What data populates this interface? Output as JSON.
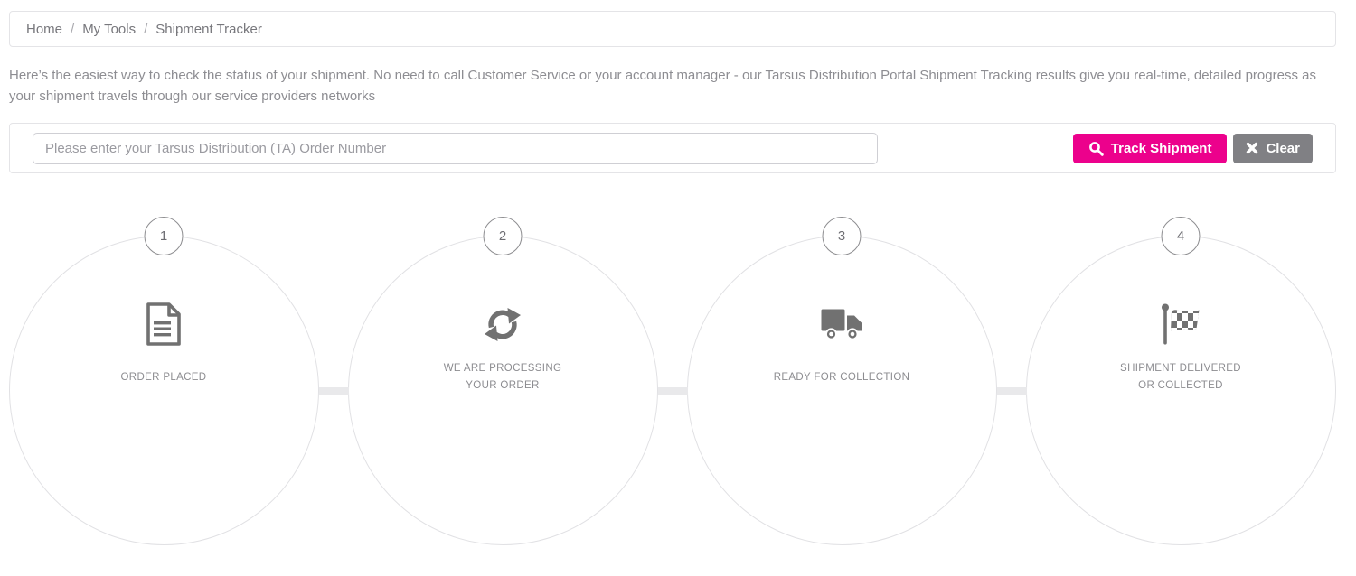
{
  "breadcrumb": {
    "separator": "/",
    "items": [
      {
        "label": "Home"
      },
      {
        "label": "My Tools"
      },
      {
        "label": "Shipment Tracker"
      }
    ]
  },
  "intro_text": "Here’s the easiest way to check the status of your shipment. No need to call Customer Service or your account manager - our Tarsus Distribution Portal Shipment Tracking results give you real-time, detailed progress as your shipment travels through our service providers networks",
  "search": {
    "placeholder": "Please enter your Tarsus Distribution (TA) Order Number",
    "input_value": "",
    "track_label": "Track Shipment",
    "clear_label": "Clear",
    "track_icon": "search-icon",
    "clear_icon": "close-icon"
  },
  "steps": [
    {
      "number": "1",
      "label": "ORDER PLACED",
      "icon": "document-icon"
    },
    {
      "number": "2",
      "label": "WE ARE PROCESSING\nYOUR ORDER",
      "icon": "refresh-icon"
    },
    {
      "number": "3",
      "label": "READY FOR COLLECTION",
      "icon": "truck-icon"
    },
    {
      "number": "4",
      "label": "SHIPMENT DELIVERED\nOR COLLECTED",
      "icon": "checkered-flag-icon"
    }
  ],
  "colors": {
    "accent_pink": "#ec018c",
    "button_gray": "#808084",
    "icon_gray": "#717171",
    "circle_border": "#e1e1e4",
    "connector_gray": "#e9e9eb",
    "text_gray": "#8d8d92",
    "border_gray": "#e4e4e7"
  }
}
